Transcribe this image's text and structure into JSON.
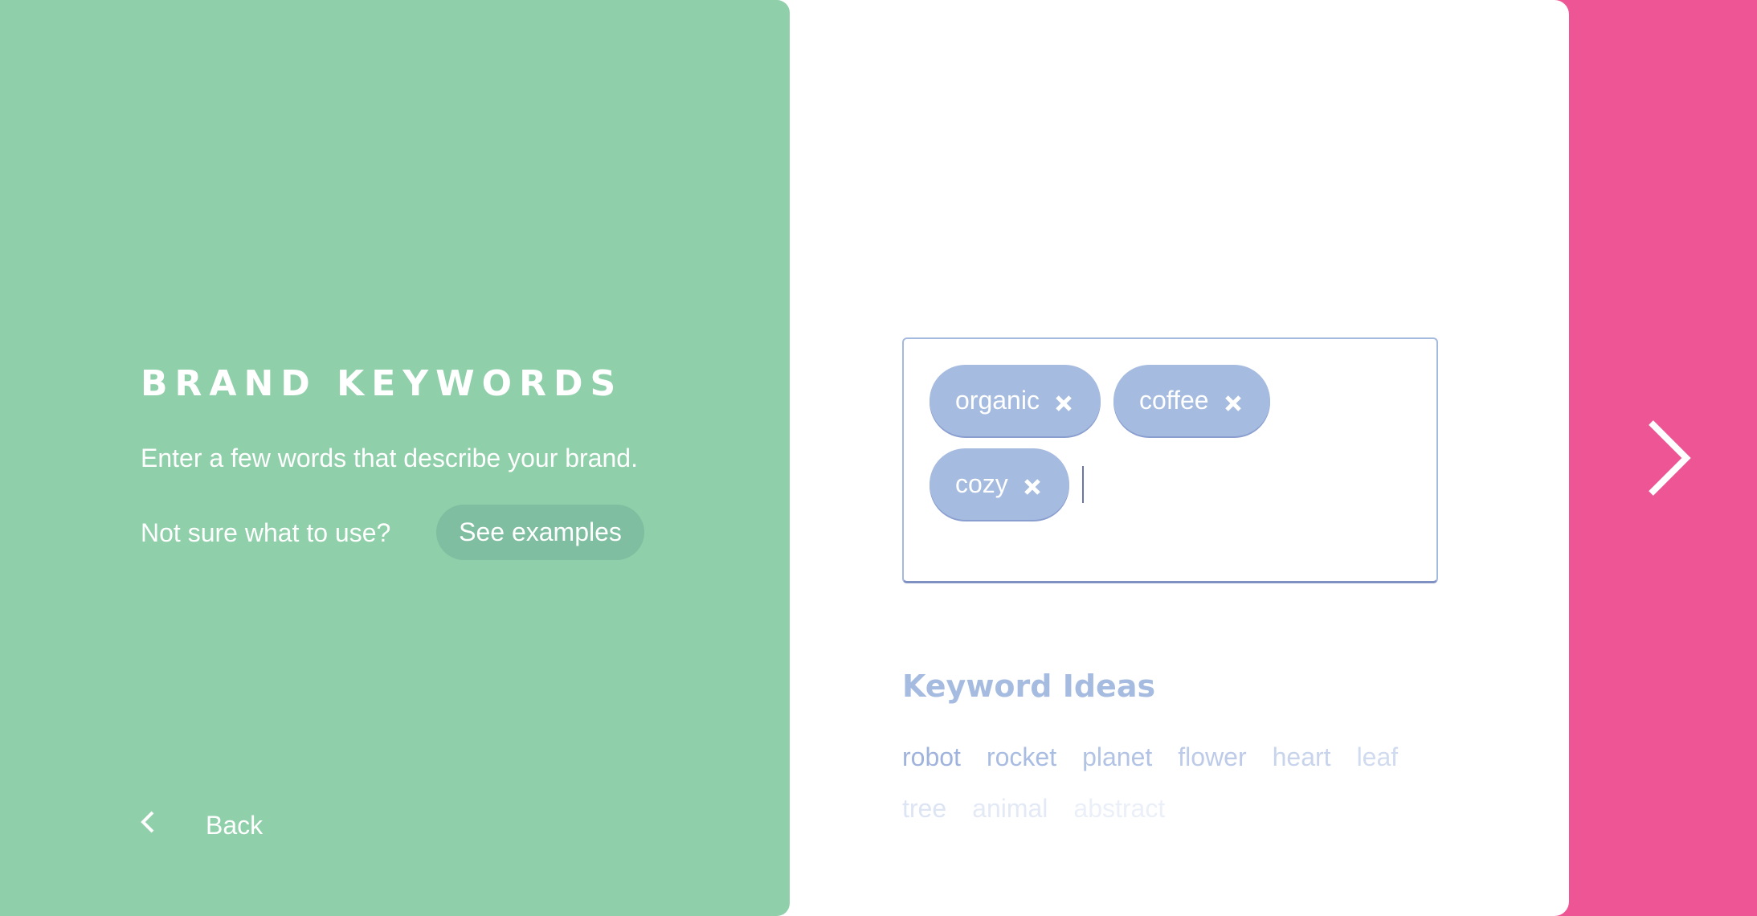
{
  "colors": {
    "green": "#8fcfa9",
    "pink": "#ee5594",
    "chip": "#a6bbe0",
    "accent_blue": "#a6bbe0"
  },
  "left_panel": {
    "title": "BRAND KEYWORDS",
    "subtitle": "Enter a few words that describe your brand.",
    "help_prompt": "Not sure what to use?",
    "examples_button": "See examples",
    "back_label": "Back",
    "back_icon": "chevron-left-icon"
  },
  "keyword_input": {
    "chips": [
      {
        "label": "organic",
        "remove_icon": "close-icon"
      },
      {
        "label": "coffee",
        "remove_icon": "close-icon"
      },
      {
        "label": "cozy",
        "remove_icon": "close-icon"
      }
    ],
    "value": ""
  },
  "keyword_ideas": {
    "title": "Keyword Ideas",
    "items": [
      {
        "label": "robot",
        "color": "#9fb3dc"
      },
      {
        "label": "rocket",
        "color": "#a9bce1"
      },
      {
        "label": "planet",
        "color": "#b2c3e4"
      },
      {
        "label": "flower",
        "color": "#bdcbe8"
      },
      {
        "label": "heart",
        "color": "#c8d4ec"
      },
      {
        "label": "leaf",
        "color": "#d1dbef"
      },
      {
        "label": "tree",
        "color": "#dde4f3"
      },
      {
        "label": "animal",
        "color": "#e3e9f5"
      },
      {
        "label": "abstract",
        "color": "#ebeff8"
      }
    ]
  },
  "right_panel": {
    "next_icon": "chevron-right-icon"
  }
}
